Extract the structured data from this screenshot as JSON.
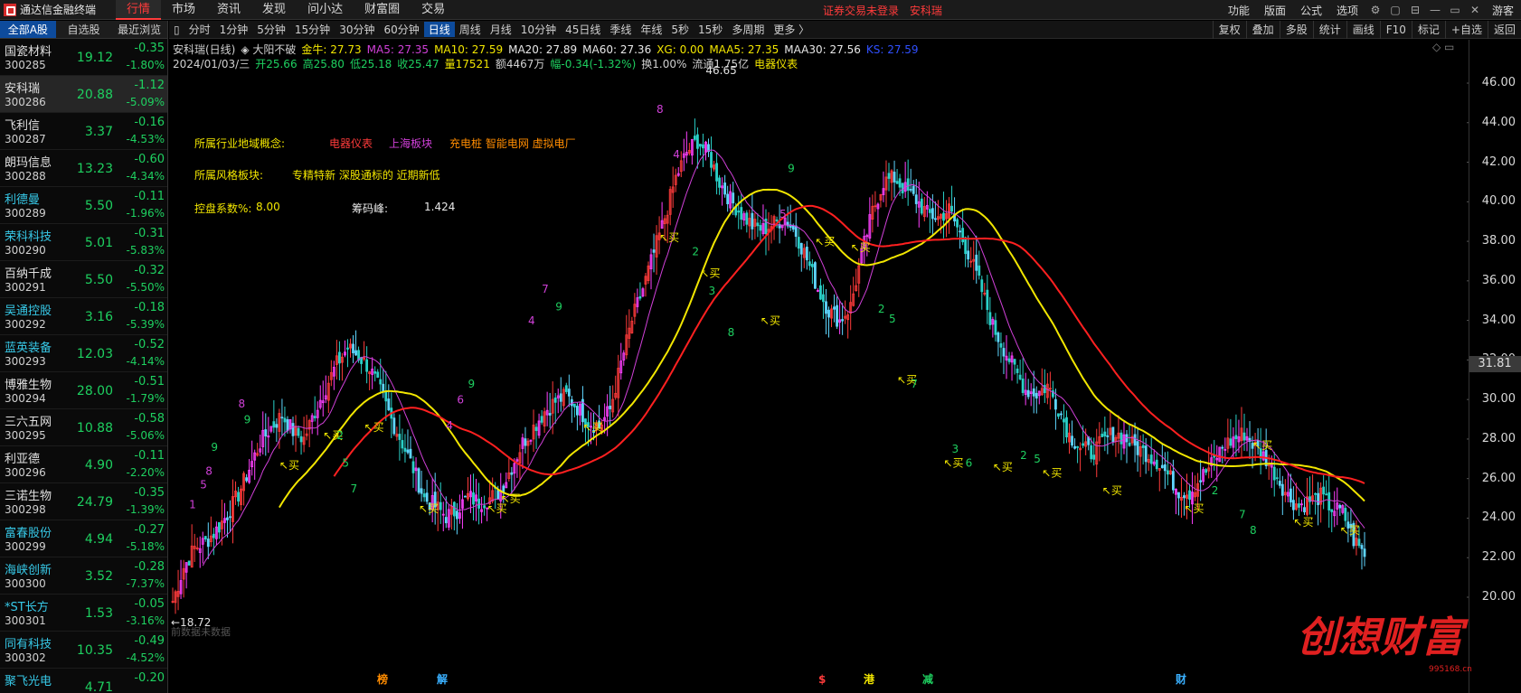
{
  "app": {
    "title": "通达信金融终端"
  },
  "menu": [
    "行情",
    "市场",
    "资讯",
    "发现",
    "问小达",
    "财富圈",
    "交易"
  ],
  "menu_active": 0,
  "top_center": {
    "warning": "证券交易未登录",
    "stock": "安科瑞"
  },
  "top_right": [
    "功能",
    "版面",
    "公式",
    "选项"
  ],
  "user": "游客",
  "left_tabs": [
    "全部A股",
    "自选股",
    "最近浏览"
  ],
  "stocks": [
    {
      "name": "国瓷材料",
      "code": "300285",
      "price": "19.12",
      "chg": "-0.35",
      "pct": "-1.80%",
      "cyan": false
    },
    {
      "name": "安科瑞",
      "code": "300286",
      "price": "20.88",
      "chg": "-1.12",
      "pct": "-5.09%",
      "cyan": false,
      "selected": true
    },
    {
      "name": "飞利信",
      "code": "300287",
      "price": "3.37",
      "chg": "-0.16",
      "pct": "-4.53%",
      "cyan": false
    },
    {
      "name": "朗玛信息",
      "code": "300288",
      "price": "13.23",
      "chg": "-0.60",
      "pct": "-4.34%",
      "cyan": false
    },
    {
      "name": "利德曼",
      "code": "300289",
      "price": "5.50",
      "chg": "-0.11",
      "pct": "-1.96%",
      "cyan": true
    },
    {
      "name": "荣科科技",
      "code": "300290",
      "price": "5.01",
      "chg": "-0.31",
      "pct": "-5.83%",
      "cyan": true
    },
    {
      "name": "百纳千成",
      "code": "300291",
      "price": "5.50",
      "chg": "-0.32",
      "pct": "-5.50%",
      "cyan": false
    },
    {
      "name": "吴通控股",
      "code": "300292",
      "price": "3.16",
      "chg": "-0.18",
      "pct": "-5.39%",
      "cyan": true
    },
    {
      "name": "蓝英装备",
      "code": "300293",
      "price": "12.03",
      "chg": "-0.52",
      "pct": "-4.14%",
      "cyan": true
    },
    {
      "name": "博雅生物",
      "code": "300294",
      "price": "28.00",
      "chg": "-0.51",
      "pct": "-1.79%",
      "cyan": false
    },
    {
      "name": "三六五网",
      "code": "300295",
      "price": "10.88",
      "chg": "-0.58",
      "pct": "-5.06%",
      "cyan": false
    },
    {
      "name": "利亚德",
      "code": "300296",
      "price": "4.90",
      "chg": "-0.11",
      "pct": "-2.20%",
      "cyan": false
    },
    {
      "name": "三诺生物",
      "code": "300298",
      "price": "24.79",
      "chg": "-0.35",
      "pct": "-1.39%",
      "cyan": false
    },
    {
      "name": "富春股份",
      "code": "300299",
      "price": "4.94",
      "chg": "-0.27",
      "pct": "-5.18%",
      "cyan": true
    },
    {
      "name": "海峡创新",
      "code": "300300",
      "price": "3.52",
      "chg": "-0.28",
      "pct": "-7.37%",
      "cyan": true
    },
    {
      "name": "*ST长方",
      "code": "300301",
      "price": "1.53",
      "chg": "-0.05",
      "pct": "-3.16%",
      "cyan": true
    },
    {
      "name": "同有科技",
      "code": "300302",
      "price": "10.35",
      "chg": "-0.49",
      "pct": "-4.52%",
      "cyan": true
    },
    {
      "name": "聚飞光电",
      "code": "",
      "price": "4.71",
      "chg": "-0.20",
      "pct": "",
      "cyan": true
    }
  ],
  "toolbar": {
    "periods": [
      "分时",
      "1分钟",
      "5分钟",
      "15分钟",
      "30分钟",
      "60分钟",
      "日线",
      "周线",
      "月线",
      "10分钟",
      "45日线",
      "季线",
      "年线",
      "5秒",
      "15秒",
      "多周期",
      "更多 〉"
    ],
    "active": "日线",
    "right": [
      "复权",
      "叠加",
      "多股",
      "统计",
      "画线",
      "F10",
      "标记",
      "+自选",
      "返回"
    ]
  },
  "legend": {
    "line1": [
      {
        "t": "安科瑞(日线)",
        "c": "#d0d0d0"
      },
      {
        "t": "◈ 大阳不破",
        "c": "#d0d0d0"
      },
      {
        "t": "金牛: 27.73",
        "c": "#f2e600"
      },
      {
        "t": "MA5: 27.35",
        "c": "#d040d8"
      },
      {
        "t": "MA10: 27.59",
        "c": "#f2e600"
      },
      {
        "t": "MA20: 27.89",
        "c": "#e8e8e8"
      },
      {
        "t": "MA60: 27.36",
        "c": "#e8e8e8"
      },
      {
        "t": "XG: 0.00",
        "c": "#f2e600"
      },
      {
        "t": "MAA5: 27.35",
        "c": "#f2e600"
      },
      {
        "t": "MAA30: 27.56",
        "c": "#e8e8e8"
      },
      {
        "t": "KS: 27.59",
        "c": "#3050ff"
      }
    ],
    "line2": [
      {
        "t": "2024/01/03/三",
        "c": "#d0d0d0"
      },
      {
        "t": "开25.66",
        "c": "#1ed060"
      },
      {
        "t": "高25.80",
        "c": "#1ed060"
      },
      {
        "t": "低25.18",
        "c": "#1ed060"
      },
      {
        "t": "收25.47",
        "c": "#1ed060"
      },
      {
        "t": "量17521",
        "c": "#f2e600"
      },
      {
        "t": "额4467万",
        "c": "#d0d0d0"
      },
      {
        "t": "幅-0.34(-1.32%)",
        "c": "#1ed060"
      },
      {
        "t": "换1.00%",
        "c": "#d0d0d0"
      },
      {
        "t": "流通1.75亿",
        "c": "#d0d0d0"
      },
      {
        "t": "电器仪表",
        "c": "#f2e600"
      }
    ]
  },
  "info": {
    "industry_label": "所属行业地域概念:",
    "industry": "电器仪表",
    "region": "上海板块",
    "concepts": "充电桩 智能电网 虚拟电厂",
    "style_label": "所属风格板块:",
    "style": "专精特新 深股通标的 近期新低",
    "control_label": "控盘系数%:",
    "control_value": "8.00",
    "chip_label": "筹码峰:",
    "chip_value": "1.424"
  },
  "current_price": "31.81",
  "chart_data": {
    "type": "line",
    "title": "安科瑞(日线)",
    "ylim": [
      19.5,
      46.65
    ],
    "yticks": [
      "46.00",
      "44.00",
      "42.00",
      "40.00",
      "38.00",
      "36.00",
      "34.00",
      "32.00",
      "30.00",
      "28.00",
      "26.00",
      "24.00",
      "22.00",
      "20.00"
    ],
    "high_label": "46.65",
    "low_label": "18.72",
    "no_data_text": "前数据未数据",
    "buy_label": "买",
    "event_markers": [
      {
        "label": "榜",
        "c": "#ff8c00"
      },
      {
        "label": "解",
        "c": "#3ab0ff"
      },
      {
        "label": "$",
        "c": "#ff3b3b"
      },
      {
        "label": "港",
        "c": "#f2e600"
      },
      {
        "label": "减",
        "c": "#1ed060"
      },
      {
        "label": "财",
        "c": "#3ab0ff"
      }
    ],
    "series": [
      {
        "name": "MA5",
        "color": "#d040d8"
      },
      {
        "name": "MA10",
        "color": "#f2e600"
      },
      {
        "name": "MA20",
        "color": "#ff2020"
      }
    ],
    "closes": [
      19.8,
      21.5,
      22.5,
      22.8,
      23.4,
      24.2,
      25.2,
      26.5,
      27.8,
      28.6,
      29.2,
      28.4,
      28.0,
      29.4,
      30.6,
      31.8,
      32.6,
      32.2,
      31.6,
      30.4,
      29.0,
      27.8,
      26.5,
      25.0,
      24.6,
      24.1,
      24.4,
      25.1,
      24.8,
      25.0,
      25.4,
      26.6,
      27.8,
      28.6,
      29.4,
      29.9,
      30.2,
      29.6,
      28.9,
      28.6,
      29.5,
      31.8,
      34.0,
      35.6,
      37.4,
      39.2,
      41.2,
      42.5,
      43.1,
      42.4,
      41.0,
      40.1,
      39.4,
      38.8,
      38.6,
      38.9,
      39.2,
      38.4,
      37.1,
      35.6,
      34.5,
      34.0,
      34.7,
      37.3,
      39.5,
      41.0,
      41.2,
      40.6,
      40.1,
      39.4,
      39.2,
      39.6,
      38.4,
      37.1,
      35.5,
      33.7,
      32.6,
      31.5,
      30.5,
      30.3,
      30.7,
      29.6,
      28.2,
      27.6,
      27.3,
      27.8,
      28.3,
      28.1,
      27.6,
      27.3,
      26.9,
      26.2,
      25.4,
      25.3,
      26.0,
      26.7,
      27.6,
      28.0,
      28.3,
      27.6,
      27.0,
      26.1,
      25.1,
      24.6,
      24.9,
      25.1,
      24.5,
      24.3,
      22.9,
      22.2
    ]
  }
}
